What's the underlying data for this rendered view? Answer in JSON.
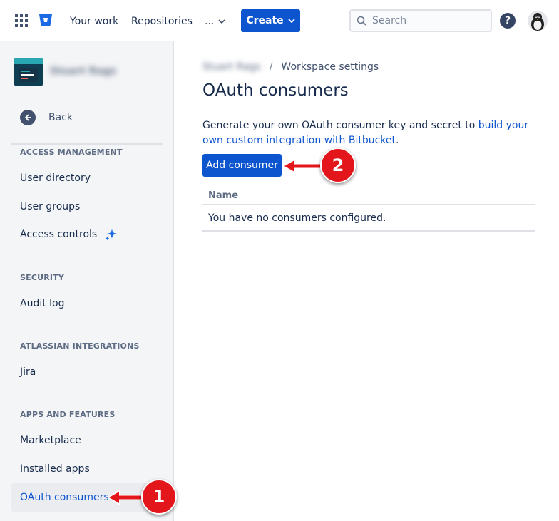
{
  "topbar": {
    "nav": {
      "your_work": "Your work",
      "repositories": "Repositories",
      "more": "..."
    },
    "create_label": "Create",
    "search": {
      "placeholder": "Search",
      "value": ""
    },
    "help_glyph": "?",
    "icons": [
      "app-switcher-icon",
      "bitbucket-logo",
      "chevron-down-icon",
      "search-icon",
      "help-icon",
      "avatar"
    ]
  },
  "sidebar": {
    "workspace_name": "Stuart Rags",
    "back_label": "Back",
    "sections": {
      "access_management": "ACCESS MANAGEMENT",
      "security": "SECURITY",
      "atlassian_integrations": "ATLASSIAN INTEGRATIONS",
      "apps_and_features": "APPS AND FEATURES"
    },
    "items": {
      "user_directory": "User directory",
      "user_groups": "User groups",
      "access_controls": "Access controls",
      "audit_log": "Audit log",
      "jira": "Jira",
      "marketplace": "Marketplace",
      "installed_apps": "Installed apps",
      "oauth_consumers": "OAuth consumers"
    },
    "active_item": "OAuth consumers"
  },
  "main": {
    "breadcrumb": {
      "workspace": "Stuart Rags",
      "separator": "/",
      "current": "Workspace settings"
    },
    "title": "OAuth consumers",
    "description": {
      "text": "Generate your own OAuth consumer key and secret to ",
      "link": "build your own custom integration with Bitbucket",
      "suffix": "."
    },
    "add_button_label": "Add consumer",
    "table": {
      "columns": [
        "Name"
      ],
      "empty_message": "You have no consumers configured."
    }
  },
  "annotations": {
    "step1": "1",
    "step2": "2"
  },
  "colors": {
    "primary_blue": "#0c55cf",
    "text": "#172b4d",
    "sidebar_bg": "#f4f5f7",
    "callout_red": "#e3161b"
  }
}
